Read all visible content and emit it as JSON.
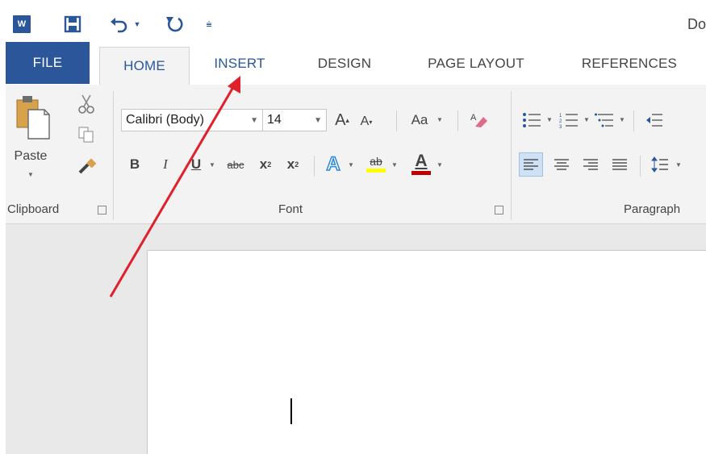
{
  "title_bar": {
    "app_icon_text": "W",
    "doc_title_partial": "Do"
  },
  "tabs": [
    {
      "label": "FILE"
    },
    {
      "label": "HOME"
    },
    {
      "label": "INSERT"
    },
    {
      "label": "DESIGN"
    },
    {
      "label": "PAGE LAYOUT"
    },
    {
      "label": "REFERENCES"
    }
  ],
  "clipboard": {
    "paste_label": "Paste",
    "group_label": "Clipboard"
  },
  "font": {
    "font_name": "Calibri (Body)",
    "font_size": "14",
    "change_case_label": "Aa",
    "bold_label": "B",
    "italic_label": "I",
    "underline_label": "U",
    "strike_label": "abc",
    "subscript_label": "x",
    "subscript_suffix": "2",
    "superscript_label": "x",
    "superscript_suffix": "2",
    "text_effects_label": "A",
    "highlight_label": "ab",
    "font_color_label": "A",
    "group_label": "Font"
  },
  "paragraph": {
    "group_label": "Paragraph"
  },
  "colors": {
    "brand_blue": "#2b579a",
    "highlight_yellow": "#ffff00",
    "font_color_red": "#c00000",
    "annotation_arrow": "#e0202a"
  }
}
